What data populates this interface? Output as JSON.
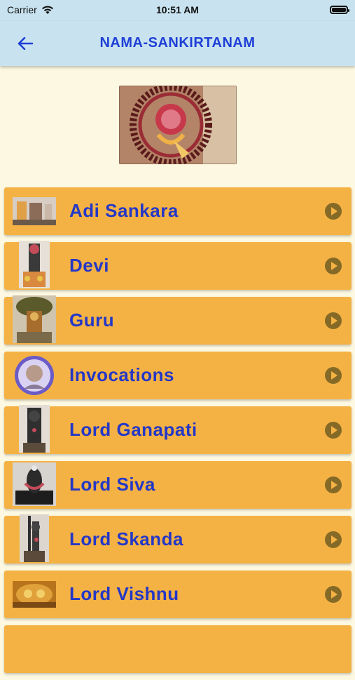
{
  "status_bar": {
    "carrier": "Carrier",
    "time": "10:51 AM"
  },
  "nav": {
    "title": "NAMA-SANKIRTANAM"
  },
  "items": [
    {
      "label": "Adi Sankara"
    },
    {
      "label": "Devi"
    },
    {
      "label": "Guru"
    },
    {
      "label": "Invocations"
    },
    {
      "label": "Lord Ganapati"
    },
    {
      "label": "Lord Siva"
    },
    {
      "label": "Lord Skanda"
    },
    {
      "label": "Lord Vishnu"
    }
  ],
  "colors": {
    "bar_background": "#c8e3ef",
    "page_background": "#fcf8e1",
    "row_background": "#f5b244",
    "accent_text": "#1f3fd6",
    "play_icon": "#856a27"
  }
}
